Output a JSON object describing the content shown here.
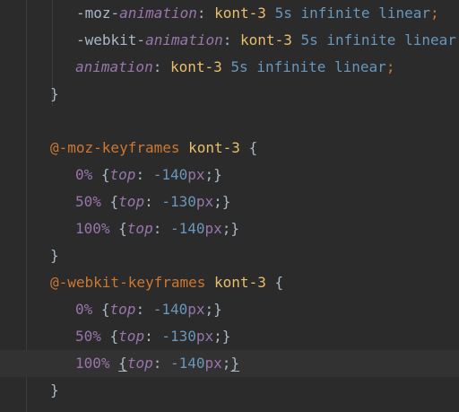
{
  "editor": {
    "lines": [
      {
        "tokens": [
          "-moz-",
          "animation",
          ": ",
          "kont-3",
          " ",
          "5s",
          " ",
          "infinite",
          " ",
          "linear",
          ";"
        ]
      },
      {
        "tokens": [
          "-webkit-",
          "animation",
          ": ",
          "kont-3",
          " ",
          "5s",
          " ",
          "infinite",
          " ",
          "linear",
          ";"
        ]
      },
      {
        "tokens": [
          "animation",
          ": ",
          "kont-3",
          " ",
          "5s",
          " ",
          "infinite",
          " ",
          "linear",
          ";"
        ]
      },
      {
        "tokens": [
          "}"
        ]
      },
      {
        "tokens": []
      },
      {
        "tokens": [
          "@-moz-keyframes",
          " ",
          "kont-3",
          " {"
        ]
      },
      {
        "tokens": [
          "0%",
          " {",
          "top",
          ": ",
          "-140",
          "px",
          ";}"
        ]
      },
      {
        "tokens": [
          "50%",
          " {",
          "top",
          ": ",
          "-130",
          "px",
          ";}"
        ]
      },
      {
        "tokens": [
          "100%",
          " {",
          "top",
          ": ",
          "-140",
          "px",
          ";}"
        ]
      },
      {
        "tokens": [
          "}"
        ]
      },
      {
        "tokens": [
          "@-webkit-keyframes",
          " ",
          "kont-3",
          " {"
        ]
      },
      {
        "tokens": [
          "0%",
          " {",
          "top",
          ": ",
          "-140",
          "px",
          ";}"
        ]
      },
      {
        "tokens": [
          "50%",
          " {",
          "top",
          ": ",
          "-130",
          "px",
          ";}"
        ]
      },
      {
        "tokens": [
          "100%",
          " ",
          "{",
          "top",
          ": ",
          "-140",
          "px",
          ";",
          "}"
        ]
      },
      {
        "tokens": [
          "}"
        ]
      }
    ]
  },
  "colors": {
    "background": "#2b2b2b",
    "current_line": "#323232",
    "text": "#a9b7c6",
    "property": "#9876aa",
    "keyword": "#cc7832",
    "name": "#e8bf6a",
    "number": "#6897bb"
  }
}
